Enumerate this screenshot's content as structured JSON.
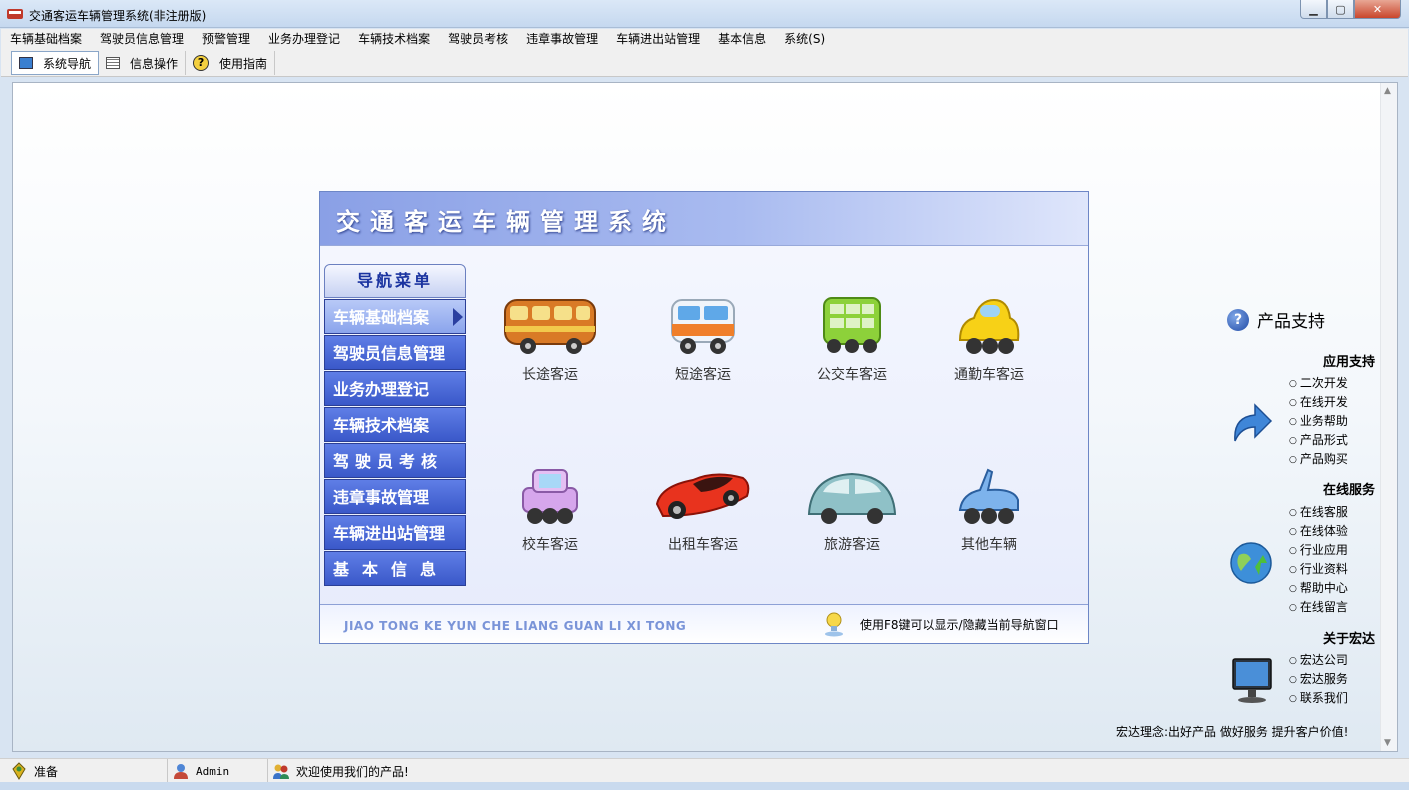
{
  "window": {
    "title": "交通客运车辆管理系统(非注册版)"
  },
  "menu": [
    "车辆基础档案",
    "驾驶员信息管理",
    "预警管理",
    "业务办理登记",
    "车辆技术档案",
    "驾驶员考核",
    "违章事故管理",
    "车辆进出站管理",
    "基本信息",
    "系统(S)"
  ],
  "toolbar": {
    "nav": "系统导航",
    "info": "信息操作",
    "guide": "使用指南"
  },
  "navwin": {
    "title": "交通客运车辆管理系统",
    "menu_head": "导航菜单",
    "items": [
      "车辆基础档案",
      "驾驶员信息管理",
      "业务办理登记",
      "车辆技术档案",
      "驾驶员考核",
      "违章事故管理",
      "车辆进出站管理",
      "基本信息"
    ],
    "vehicles": [
      "长途客运",
      "短途客运",
      "公交车客运",
      "通勤车客运",
      "校车客运",
      "出租车客运",
      "旅游客运",
      "其他车辆"
    ],
    "pinyin": "JIAO TONG KE YUN CHE LIANG GUAN LI XI TONG",
    "hint": "使用F8键可以显示/隐藏当前导航窗口"
  },
  "support": {
    "title": "产品支持",
    "app_head": "应用支持",
    "app_links": [
      "二次开发",
      "在线开发",
      "业务帮助",
      "产品形式",
      "产品购买"
    ],
    "online_head": "在线服务",
    "online_links": [
      "在线客服",
      "在线体验",
      "行业应用",
      "行业资料",
      "帮助中心",
      "在线留言"
    ],
    "about_head": "关于宏达",
    "about_links": [
      "宏达公司",
      "宏达服务",
      "联系我们"
    ],
    "motto": "宏达理念:出好产品  做好服务  提升客户价值!"
  },
  "status": {
    "ready": "准备",
    "user": "Admin",
    "welcome": "欢迎使用我们的产品!"
  }
}
